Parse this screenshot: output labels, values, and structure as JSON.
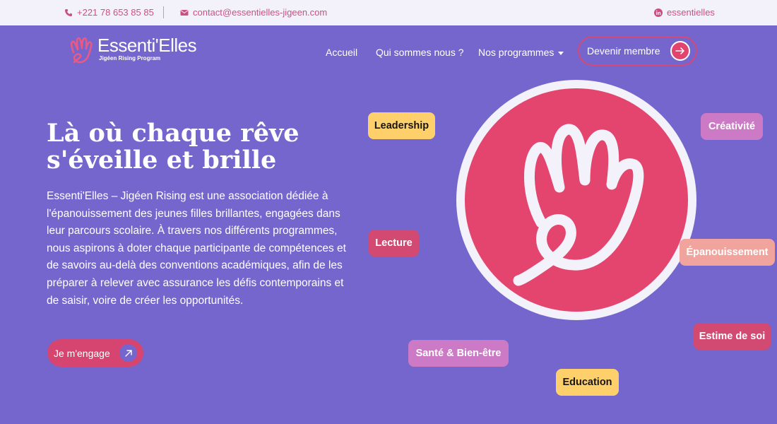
{
  "topbar": {
    "phone": "+221 78 653 85 85",
    "email": "contact@essentielles-jigeen.com",
    "social": "essentielles",
    "phone_icon": "phone-icon",
    "email_icon": "envelope-icon",
    "social_icon": "linkedin-icon"
  },
  "brand": {
    "name": "Essenti'Elles",
    "tagline": "Jigéen Rising Program"
  },
  "nav": {
    "home": "Accueil",
    "about": "Qui sommes nous ?",
    "programs": "Nos programmes",
    "cta": "Devenir membre"
  },
  "hero": {
    "title_line1": "Là où chaque rêve",
    "title_line2": "s'éveille et brille",
    "text": "Essenti'Elles – Jigéen Rising est une association dédiée à l'épanouissement des jeunes filles brillantes, engagées dans leur parcours scolaire. À travers nos différents programmes, nous aspirons à doter chaque participante de compétences et de savoirs au-delà des conventions académiques, afin de les préparer à relever avec assurance les défis contemporains et de saisir, voire de créer les opportunités.",
    "cta": "Je m'engage"
  },
  "tags": {
    "leadership": "Leadership",
    "creativite": "Créativité",
    "lecture": "Lecture",
    "epanouissement": "Épanouissement",
    "estime": "Estime de soi",
    "sante": "Santé & Bien-être",
    "education": "Education"
  },
  "colors": {
    "background": "#7466cc",
    "accent_pink": "#e3456f",
    "topbar": "#f3f2fb",
    "yellow": "#fed06b",
    "mauve": "#cc7ac5",
    "salmon": "#f1a39d"
  }
}
